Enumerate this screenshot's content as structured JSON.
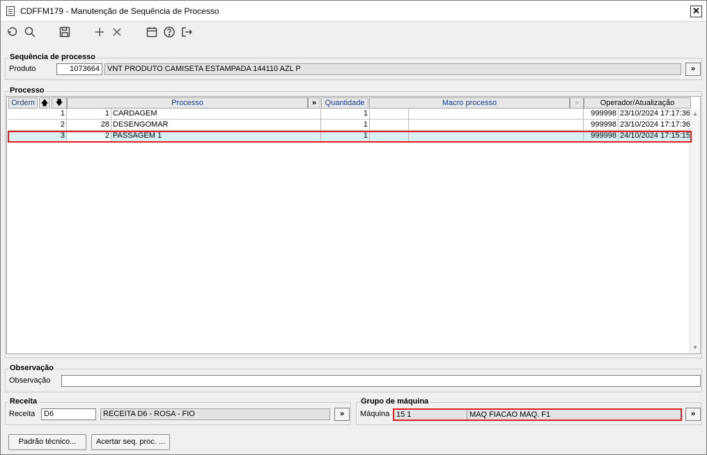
{
  "window": {
    "title": "CDFFM179 - Manutenção de Sequência de Processo",
    "close_label": "✕"
  },
  "toolbar": {
    "icons": [
      "undo-icon",
      "search-icon",
      "save-icon",
      "add-icon",
      "delete-icon",
      "calendar-icon",
      "help-icon",
      "exit-icon"
    ]
  },
  "sequencia": {
    "title": "Sequência de processo",
    "produto_label": "Produto",
    "produto_code": "1073664",
    "produto_desc": "VNT PRODUTO CAMISETA ESTAMPADA 144110 AZL P",
    "more": "»"
  },
  "processo": {
    "title": "Processo",
    "headers": {
      "ordem": "Ordem",
      "processo": "Processo",
      "quantidade": "Quantidade",
      "macro": "Macro processo",
      "operador": "Operador/Atualização",
      "more": "»"
    },
    "rows": [
      {
        "ordem": "1",
        "cod": "1",
        "processo": "CARDAGEM",
        "quantidade": "1",
        "macro_cod": "",
        "macro": "",
        "operador": "999998",
        "atualizacao": "23/10/2024 17:17:36"
      },
      {
        "ordem": "2",
        "cod": "28",
        "processo": "DESENGOMAR",
        "quantidade": "1",
        "macro_cod": "",
        "macro": "",
        "operador": "999998",
        "atualizacao": "23/10/2024 17:17:36"
      },
      {
        "ordem": "3",
        "cod": "2",
        "processo": "PASSAGEM 1",
        "quantidade": "1",
        "macro_cod": "",
        "macro": "",
        "operador": "999998",
        "atualizacao": "24/10/2024 17:15:15"
      }
    ]
  },
  "observacao": {
    "title": "Observação",
    "label": "Observação",
    "value": ""
  },
  "receita": {
    "title": "Receita",
    "label": "Receita",
    "code": "D6",
    "desc": "RECEITA D6 - ROSA - FIO",
    "more": "»"
  },
  "grupo": {
    "title": "Grupo de máquina",
    "label": "Máquina",
    "code": "15 1",
    "desc": "MAQ FIACAO MAQ. F1",
    "more": "»"
  },
  "buttons": {
    "padrao": "Padrão técnico...",
    "acertar": "Acertar seq. proc. ..."
  }
}
